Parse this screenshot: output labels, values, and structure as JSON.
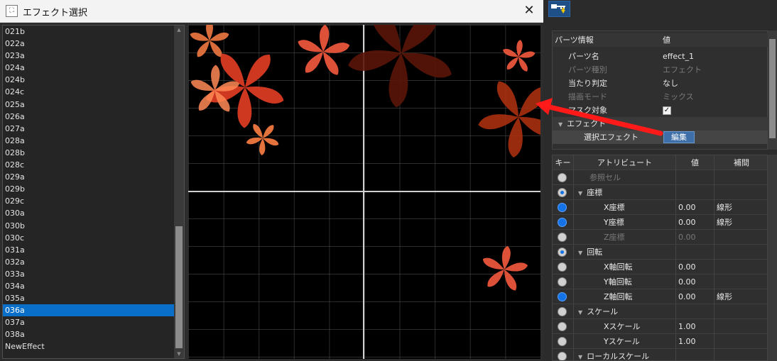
{
  "dialog": {
    "title": "エフェクト選択",
    "app_icon": "window-app-icon",
    "close_label": "✕"
  },
  "effect_list": {
    "items": [
      "021b",
      "022a",
      "023a",
      "024a",
      "024b",
      "024c",
      "025a",
      "026a",
      "027a",
      "028a",
      "028b",
      "028c",
      "029a",
      "029b",
      "029c",
      "030a",
      "030b",
      "030c",
      "031a",
      "032a",
      "033a",
      "034a",
      "035a",
      "036a",
      "037a",
      "038a",
      "NewEffect"
    ],
    "selected": "036a"
  },
  "preview": {
    "petal_colors": [
      "#e8553a",
      "#f07840",
      "#d93a22",
      "#ff8a55",
      "#5a1508"
    ]
  },
  "toolbar": {
    "key_icon": "key-download-icon",
    "key_icon_color": "#f0c400"
  },
  "parts_info": {
    "header": {
      "key": "パーツ情報",
      "value": "値"
    },
    "rows": [
      {
        "key": "パーツ名",
        "value": "effect_1",
        "disabled": false
      },
      {
        "key": "パーツ種別",
        "value": "エフェクト",
        "disabled": true
      },
      {
        "key": "当たり判定",
        "value": "なし",
        "disabled": false
      },
      {
        "key": "描画モード",
        "value": "ミックス",
        "disabled": true
      },
      {
        "key": "マスク対象",
        "value": "✓",
        "disabled": false
      },
      {
        "key": "エフェクト",
        "value": "",
        "disabled": false
      },
      {
        "key": "選択エフェクト",
        "value": "編集",
        "disabled": false
      }
    ]
  },
  "attributes": {
    "headers": {
      "key": "キー",
      "attr": "アトリビュート",
      "value": "値",
      "interp": "補間"
    },
    "rows": [
      {
        "name": "参照セル",
        "value": "",
        "interp": "",
        "dot": "gray",
        "group": false,
        "disabled": true
      },
      {
        "name": "座標",
        "value": "",
        "interp": "",
        "dot": "ring",
        "group": true,
        "disabled": false
      },
      {
        "name": "X座標",
        "value": "0.00",
        "interp": "線形",
        "dot": "blue",
        "group": false,
        "disabled": false
      },
      {
        "name": "Y座標",
        "value": "0.00",
        "interp": "線形",
        "dot": "blue",
        "group": false,
        "disabled": false
      },
      {
        "name": "Z座標",
        "value": "0.00",
        "interp": "",
        "dot": "gray",
        "group": false,
        "disabled": true
      },
      {
        "name": "回転",
        "value": "",
        "interp": "",
        "dot": "ring",
        "group": true,
        "disabled": false
      },
      {
        "name": "X軸回転",
        "value": "0.00",
        "interp": "",
        "dot": "gray",
        "group": false,
        "disabled": false
      },
      {
        "name": "Y軸回転",
        "value": "0.00",
        "interp": "",
        "dot": "gray",
        "group": false,
        "disabled": false
      },
      {
        "name": "Z軸回転",
        "value": "0.00",
        "interp": "線形",
        "dot": "blue",
        "group": false,
        "disabled": false
      },
      {
        "name": "スケール",
        "value": "",
        "interp": "",
        "dot": "gray",
        "group": true,
        "disabled": false
      },
      {
        "name": "Xスケール",
        "value": "1.00",
        "interp": "",
        "dot": "gray",
        "group": false,
        "disabled": false
      },
      {
        "name": "Yスケール",
        "value": "1.00",
        "interp": "",
        "dot": "gray",
        "group": false,
        "disabled": false
      },
      {
        "name": "ローカルスケール",
        "value": "",
        "interp": "",
        "dot": "gray",
        "group": true,
        "disabled": false
      }
    ]
  },
  "annotation": {
    "arrow_color": "#ff1a1a"
  }
}
